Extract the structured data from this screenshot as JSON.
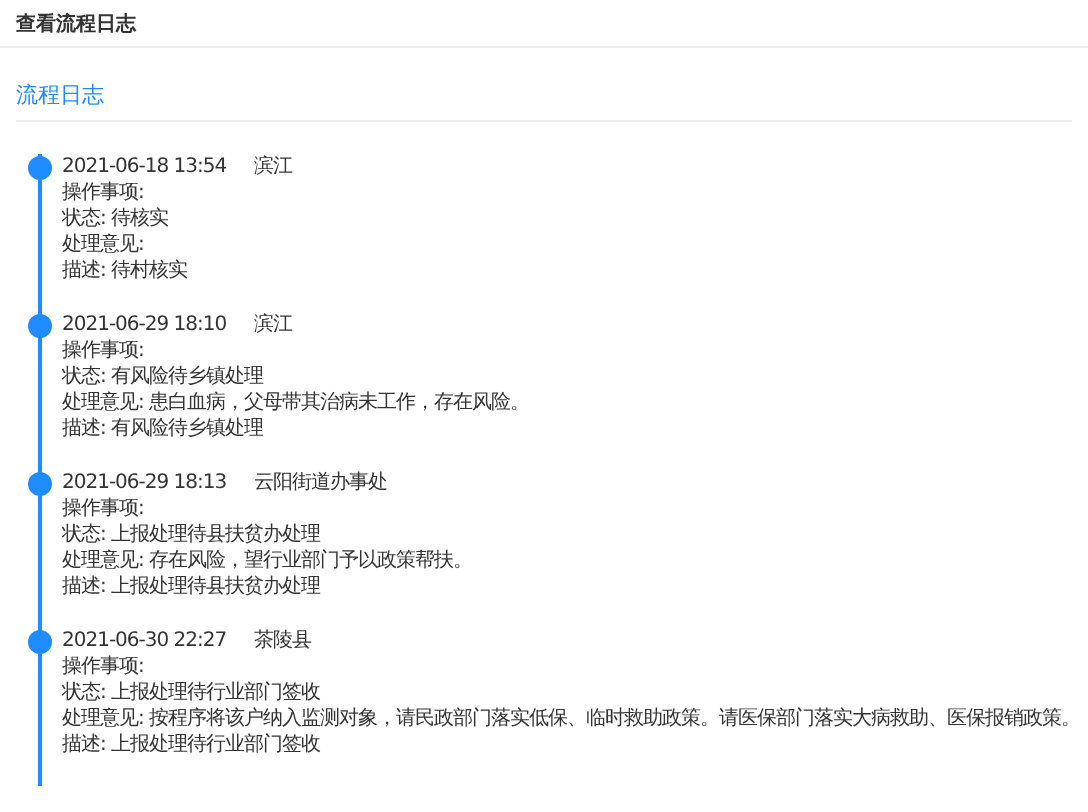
{
  "window": {
    "title": "查看流程日志"
  },
  "section": {
    "title": "流程日志"
  },
  "entries": [
    {
      "time": "2021-06-18 13:54",
      "org": "滨江",
      "lines": [
        "操作事项:",
        "状态: 待核实",
        "处理意见:",
        "描述: 待村核实"
      ]
    },
    {
      "time": "2021-06-29 18:10",
      "org": "滨江",
      "lines": [
        "操作事项:",
        "状态: 有风险待乡镇处理",
        "处理意见: 患白血病，父母带其治病未工作，存在风险。",
        "描述: 有风险待乡镇处理"
      ]
    },
    {
      "time": "2021-06-29 18:13",
      "org": "云阳街道办事处",
      "lines": [
        "操作事项:",
        "状态: 上报处理待县扶贫办处理",
        "处理意见: 存在风险，望行业部门予以政策帮扶。",
        "描述: 上报处理待县扶贫办处理"
      ]
    },
    {
      "time": "2021-06-30 22:27",
      "org": "茶陵县",
      "lines": [
        "操作事项:",
        "状态: 上报处理待行业部门签收",
        "处理意见: 按程序将该户纳入监测对象，请民政部门落实低保、临时救助政策。请医保部门落实大病救助、医保报销政策。",
        "描述: 上报处理待行业部门签收"
      ]
    }
  ]
}
